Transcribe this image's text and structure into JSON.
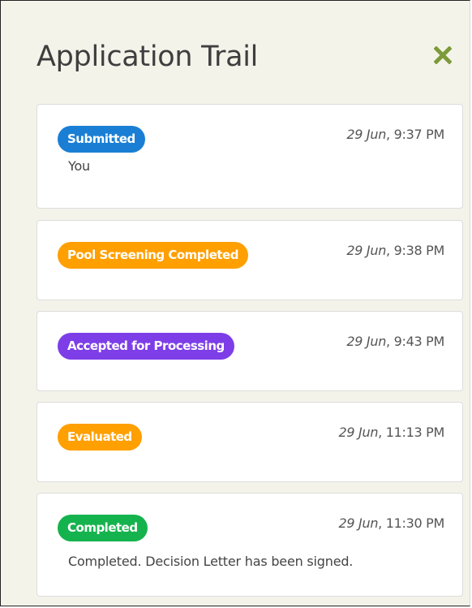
{
  "panel": {
    "title": "Application Trail",
    "close_icon": "close-x-icon",
    "close_color": "#7d9a3a"
  },
  "trail": [
    {
      "status": "Submitted",
      "status_color": "#1a7fd4",
      "date": "29 Jun",
      "time": ", 9:37 PM",
      "note": "You"
    },
    {
      "status": "Pool Screening Completed",
      "status_color": "#ff9f00",
      "date": "29 Jun",
      "time": ", 9:38 PM"
    },
    {
      "status": "Accepted for Processing",
      "status_color": "#7d3ee8",
      "date": "29 Jun",
      "time": ", 9:43 PM"
    },
    {
      "status": "Evaluated",
      "status_color": "#ff9f00",
      "date": "29 Jun",
      "time": ", 11:13 PM"
    },
    {
      "status": "Completed",
      "status_color": "#15b34d",
      "date": "29 Jun",
      "time": ", 11:30 PM",
      "note": "Completed. Decision Letter has been signed."
    }
  ]
}
